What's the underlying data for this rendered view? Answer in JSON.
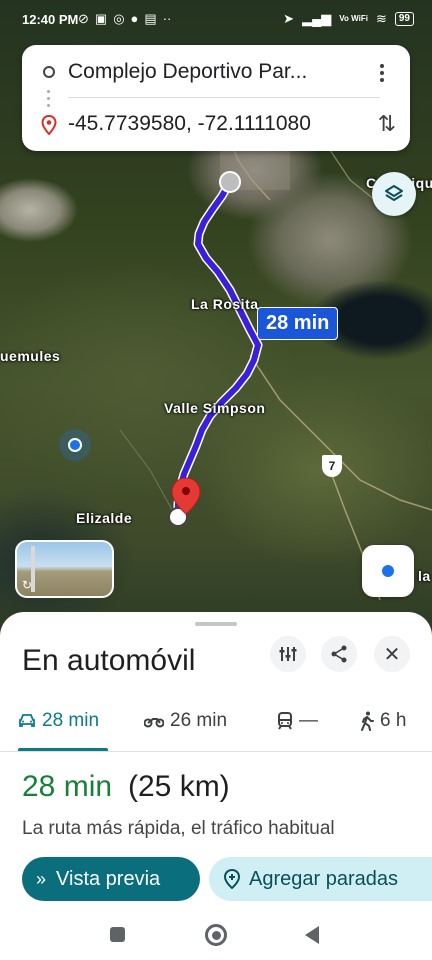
{
  "status_bar": {
    "time": "12:40 PM",
    "left_icons": [
      "signal-slash-icon",
      "app-icon",
      "instagram-icon",
      "circle-icon",
      "printer-icon",
      "more-icon"
    ],
    "voice_label": "Vo WiFi",
    "battery": "99"
  },
  "search": {
    "origin": "Complejo Deportivo Par...",
    "destination": "-45.7739580, -72.1111080"
  },
  "map": {
    "labels": {
      "la_rosita": "La Rosita",
      "valle_simpson": "Valle Simpson",
      "huemules": "uemules",
      "elizalde": "Elizalde",
      "coyhaique_partial": "Coyhaique",
      "right_edge": "la"
    },
    "route_time_badge": "28 min",
    "highway_shield": "7",
    "route_color": "#3b1fd9"
  },
  "sheet": {
    "title": "En automóvil",
    "modes": [
      {
        "icon": "car-icon",
        "label": "28 min",
        "active": true
      },
      {
        "icon": "motorcycle-icon",
        "label": "26 min",
        "active": false
      },
      {
        "icon": "train-icon",
        "label": "—",
        "active": false
      },
      {
        "icon": "walk-icon",
        "label": "6 h",
        "active": false
      }
    ],
    "summary_time": "28 min",
    "summary_distance": "(25 km)",
    "summary_desc": "La ruta más rápida, el tráfico habitual",
    "preview_label": "Vista previa",
    "add_stops_label": "Agregar paradas"
  },
  "colors": {
    "accent": "#0b7a8a",
    "time_green": "#188038",
    "primary_button": "#0b6e7d",
    "secondary_button": "#cfeff4"
  }
}
